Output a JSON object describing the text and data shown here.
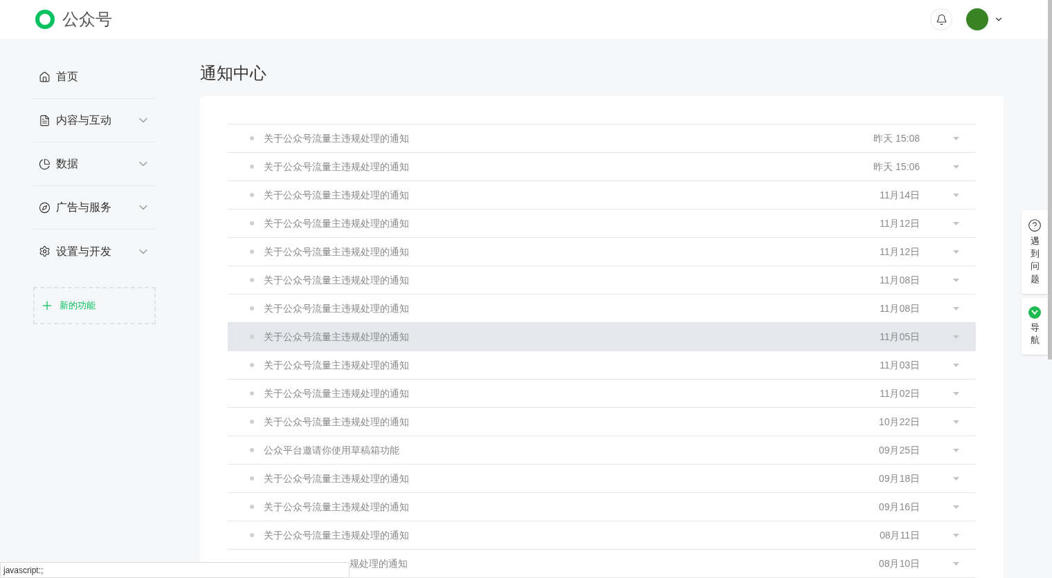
{
  "header": {
    "brand": "公众号"
  },
  "sidebar": {
    "items": [
      {
        "label": "首页",
        "kind": "home",
        "expandable": false
      },
      {
        "label": "内容与互动",
        "kind": "document",
        "expandable": true
      },
      {
        "label": "数据",
        "kind": "chart",
        "expandable": true
      },
      {
        "label": "广告与服务",
        "kind": "compass",
        "expandable": true
      },
      {
        "label": "设置与开发",
        "kind": "gear",
        "expandable": true
      }
    ],
    "add_button": "新的功能"
  },
  "page_title": "通知中心",
  "notifications": [
    {
      "title": "关于公众号流量主违规处理的通知",
      "time": "昨天 15:08",
      "selected": false
    },
    {
      "title": "关于公众号流量主违规处理的通知",
      "time": "昨天 15:06",
      "selected": false
    },
    {
      "title": "关于公众号流量主违规处理的通知",
      "time": "11月14日",
      "selected": false
    },
    {
      "title": "关于公众号流量主违规处理的通知",
      "time": "11月12日",
      "selected": false
    },
    {
      "title": "关于公众号流量主违规处理的通知",
      "time": "11月12日",
      "selected": false
    },
    {
      "title": "关于公众号流量主违规处理的通知",
      "time": "11月08日",
      "selected": false
    },
    {
      "title": "关于公众号流量主违规处理的通知",
      "time": "11月08日",
      "selected": false
    },
    {
      "title": "关于公众号流量主违规处理的通知",
      "time": "11月05日",
      "selected": true
    },
    {
      "title": "关于公众号流量主违规处理的通知",
      "time": "11月03日",
      "selected": false
    },
    {
      "title": "关于公众号流量主违规处理的通知",
      "time": "11月02日",
      "selected": false
    },
    {
      "title": "关于公众号流量主违规处理的通知",
      "time": "10月22日",
      "selected": false
    },
    {
      "title": "公众平台邀请你使用草稿箱功能",
      "time": "09月25日",
      "selected": false
    },
    {
      "title": "关于公众号流量主违规处理的通知",
      "time": "09月18日",
      "selected": false
    },
    {
      "title": "关于公众号流量主违规处理的通知",
      "time": "09月16日",
      "selected": false
    },
    {
      "title": "关于公众号流量主违规处理的通知",
      "time": "08月11日",
      "selected": false
    },
    {
      "title": "规处理的通知",
      "time": "08月10日",
      "selected": false,
      "kind": "partial"
    }
  ],
  "side_widgets": [
    {
      "label": "遇到问题",
      "kind": "help"
    },
    {
      "label": "导航",
      "kind": "nav"
    }
  ],
  "status_bar": "javascript:;"
}
